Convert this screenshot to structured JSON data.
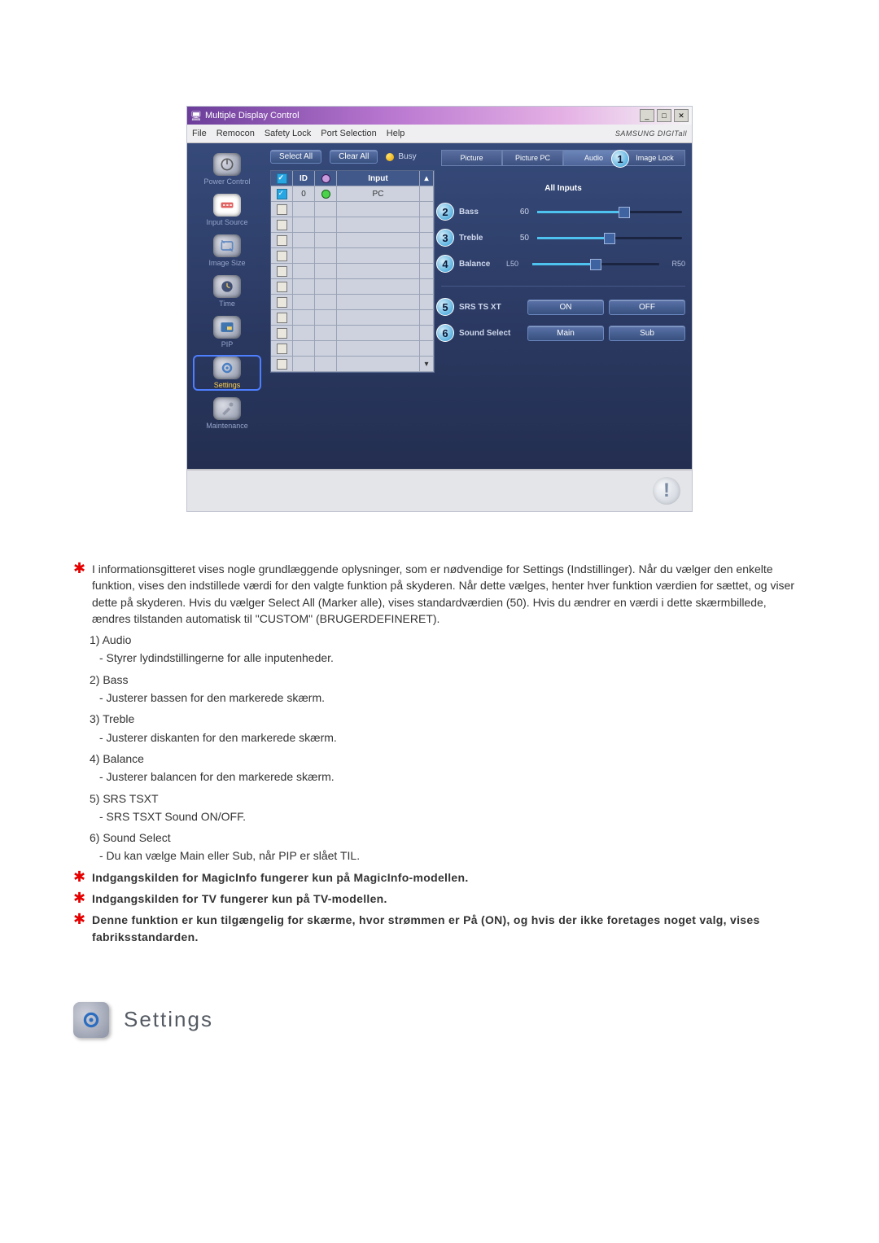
{
  "window": {
    "title": "Multiple Display Control",
    "menus": [
      "File",
      "Remocon",
      "Safety Lock",
      "Port Selection",
      "Help"
    ],
    "brand": "SAMSUNG DIGITall"
  },
  "toolbar": {
    "select_all": "Select All",
    "clear_all": "Clear All",
    "busy": "Busy"
  },
  "grid": {
    "headers": {
      "chk": "☑",
      "id": "ID",
      "led": "●",
      "input": "Input"
    },
    "rows": [
      {
        "chk": true,
        "id": "0",
        "led": "green",
        "input": "PC"
      },
      {
        "chk": false,
        "id": "",
        "led": "",
        "input": ""
      },
      {
        "chk": false,
        "id": "",
        "led": "",
        "input": ""
      },
      {
        "chk": false,
        "id": "",
        "led": "",
        "input": ""
      },
      {
        "chk": false,
        "id": "",
        "led": "",
        "input": ""
      },
      {
        "chk": false,
        "id": "",
        "led": "",
        "input": ""
      },
      {
        "chk": false,
        "id": "",
        "led": "",
        "input": ""
      },
      {
        "chk": false,
        "id": "",
        "led": "",
        "input": ""
      },
      {
        "chk": false,
        "id": "",
        "led": "",
        "input": ""
      },
      {
        "chk": false,
        "id": "",
        "led": "",
        "input": ""
      },
      {
        "chk": false,
        "id": "",
        "led": "",
        "input": ""
      },
      {
        "chk": false,
        "id": "",
        "led": "",
        "input": ""
      }
    ]
  },
  "sidebar": {
    "items": [
      {
        "label": "Power Control"
      },
      {
        "label": "Input Source"
      },
      {
        "label": "Image Size"
      },
      {
        "label": "Time"
      },
      {
        "label": "PIP"
      },
      {
        "label": "Settings"
      },
      {
        "label": "Maintenance"
      }
    ]
  },
  "tabs": {
    "items": [
      {
        "label": "Picture"
      },
      {
        "label": "Picture PC"
      },
      {
        "label": "Audio",
        "badge": "1",
        "active": true
      },
      {
        "label": "Image Lock"
      }
    ]
  },
  "panel": {
    "all_inputs": "All Inputs",
    "sliders": {
      "bass": {
        "badge": "2",
        "label": "Bass",
        "value": "60",
        "percent": 60
      },
      "treble": {
        "badge": "3",
        "label": "Treble",
        "value": "50",
        "percent": 50
      },
      "balance": {
        "badge": "4",
        "label": "Balance",
        "left": "L50",
        "right": "R50",
        "percent": 50
      }
    },
    "toggles": {
      "srs": {
        "badge": "5",
        "label": "SRS TS XT",
        "on": "ON",
        "off": "OFF"
      },
      "sound": {
        "badge": "6",
        "label": "Sound Select",
        "on": "Main",
        "off": "Sub"
      }
    }
  },
  "doc": {
    "intro": "I informationsgitteret vises nogle grundlæggende oplysninger, som er nødvendige for Settings (Indstillinger). Når du vælger den enkelte funktion, vises den indstillede værdi for den valgte funktion på skyderen. Når dette vælges, henter hver funktion værdien for sættet, og viser dette på skyderen. Hvis du vælger Select All (Marker alle), vises standardværdien (50). Hvis du ændrer en værdi i dette skærmbillede, ændres tilstanden automatisk til \"CUSTOM\" (BRUGERDEFINERET).",
    "items": [
      {
        "num": "1)",
        "title": "Audio",
        "sub": "- Styrer lydindstillingerne for alle inputenheder."
      },
      {
        "num": "2)",
        "title": "Bass",
        "sub": "- Justerer bassen for den markerede skærm."
      },
      {
        "num": "3)",
        "title": "Treble",
        "sub": "- Justerer diskanten for den markerede skærm."
      },
      {
        "num": "4)",
        "title": "Balance",
        "sub": "- Justerer balancen for den markerede skærm."
      },
      {
        "num": "5)",
        "title": "SRS TSXT",
        "sub": "- SRS TSXT Sound ON/OFF."
      },
      {
        "num": "6)",
        "title": "Sound Select",
        "sub": "- Du kan vælge Main eller Sub, når PIP er slået TIL."
      }
    ],
    "notes": [
      "Indgangskilden for MagicInfo fungerer kun på MagicInfo-modellen.",
      "Indgangskilden for TV fungerer kun på TV-modellen.",
      "Denne funktion er kun tilgængelig for skærme, hvor strømmen er På (ON), og hvis der ikke foretages noget valg, vises fabriksstandarden."
    ]
  },
  "heading": {
    "title": "Settings"
  }
}
